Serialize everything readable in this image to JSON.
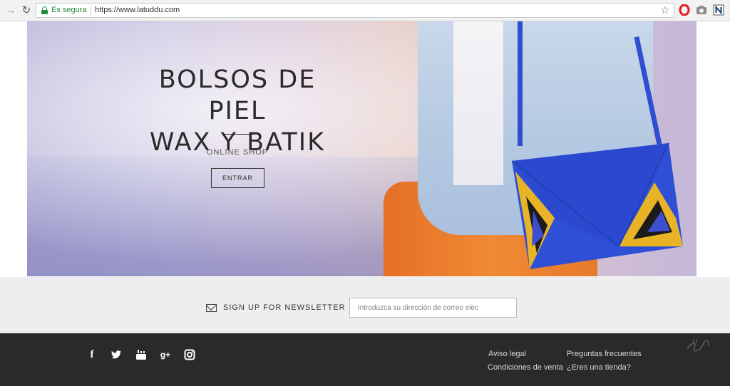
{
  "browser": {
    "secure_label": "Es segura",
    "url": "https://www.latuddu.com",
    "nav_back": "→",
    "nav_reload": "↻",
    "bookmark": "☆"
  },
  "hero": {
    "title_line1": "BOLSOS DE PIEL",
    "title_line2": "WAX Y BATIK",
    "subtitle": "ONLINE SHOP",
    "button_label": "ENTRAR"
  },
  "newsletter": {
    "label": "SIGN UP FOR NEWSLETTER",
    "placeholder": "Introduzca su dirección de correo elec"
  },
  "footer": {
    "social": {
      "facebook": "f",
      "twitter": "🐦",
      "youtube": "▶",
      "googleplus": "g+",
      "instagram": "◙"
    },
    "links": {
      "aviso_legal": "Aviso legal",
      "condiciones": "Condiciones de venta",
      "preguntas": "Preguntas frecuentes",
      "tienda": "¿Eres una tienda?"
    }
  },
  "colors": {
    "accent_blue": "#2f4fd0",
    "footer_bg": "#2a2a2a",
    "secure_green": "#1e8c3a"
  }
}
